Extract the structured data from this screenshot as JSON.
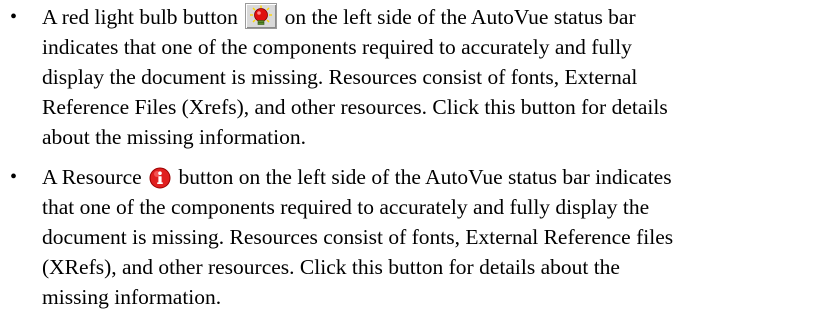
{
  "bullets": [
    {
      "marker": "•",
      "lead": "A red light bulb button",
      "icon": "red-light-bulb-icon",
      "lines": [
        "on the left side of the AutoVue status bar",
        "indicates that one of the components required to accurately and fully",
        "display the document is missing. Resources consist of fonts, External",
        "Reference Files (Xrefs), and other resources. Click this button for details",
        "about the missing information."
      ]
    },
    {
      "marker": "•",
      "lead": "A Resource",
      "icon": "resource-icon",
      "lines": [
        "button on the left side of the AutoVue status bar indicates",
        "that one of the components required to accurately and fully display the",
        "document is missing. Resources consist of fonts, External Reference files",
        "(XRefs), and other resources. Click this button for details about the",
        "missing information."
      ]
    }
  ],
  "colors": {
    "bulb_red": "#e01010",
    "bulb_glow": "#ffd400",
    "resource_red": "#e02020"
  }
}
